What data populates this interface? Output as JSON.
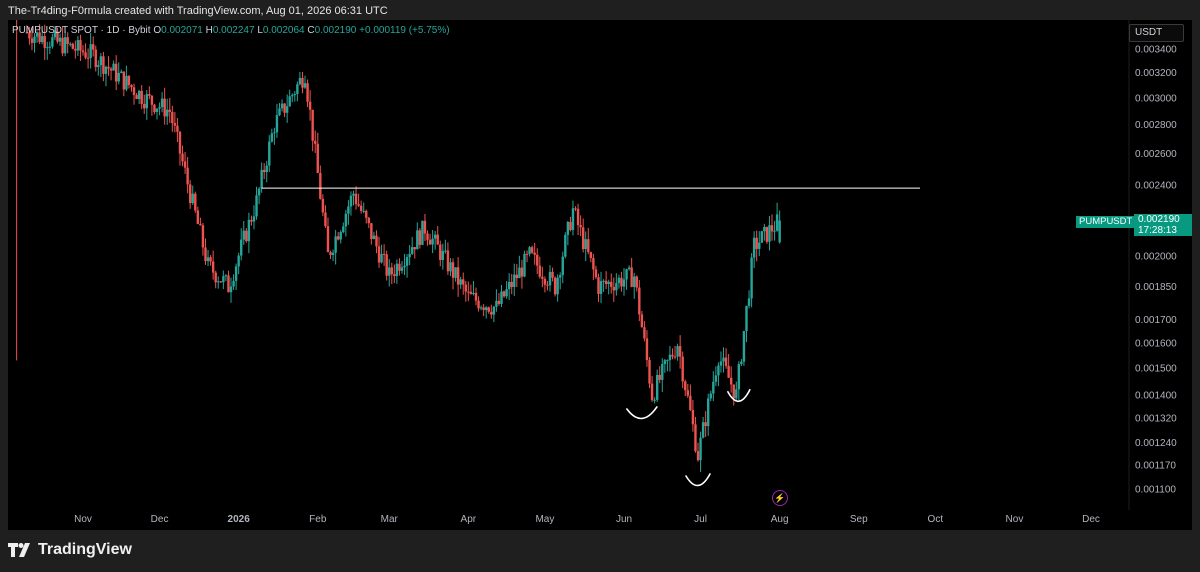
{
  "caption": "The-Tr4ding-F0rmula created with TradingView.com, Aug 01, 2026 06:31 UTC",
  "legend": {
    "symbol": "PUMPUSDT SPOT · 1D · Bybit",
    "o_label": "O",
    "o_value": "0.002071",
    "h_label": "H",
    "h_value": "0.002247",
    "l_label": "L",
    "l_value": "0.002064",
    "c_label": "C",
    "c_value": "0.002190",
    "change": "+0.000119 (+5.75%)"
  },
  "currency": "USDT",
  "price_tag": {
    "price": "0.002190",
    "countdown": "17:28:13"
  },
  "symbol_tag": "PUMPUSDT",
  "brand": "TradingView",
  "colors": {
    "up": "#26a69a",
    "down": "#ef5350",
    "tag": "#089981",
    "alert": "#9c27b0",
    "line": "#ffffff"
  },
  "icons": {
    "alert": "lightning-icon",
    "logo": "tradingview-logo-icon"
  },
  "chart_data": {
    "type": "candlestick",
    "title": "PUMPUSDT SPOT · 1D · Bybit",
    "y_ticks": [
      "0.003400",
      "0.003200",
      "0.003000",
      "0.002800",
      "0.002600",
      "0.002400",
      "0.002000",
      "0.001850",
      "0.001700",
      "0.001600",
      "0.001500",
      "0.001400",
      "0.001320",
      "0.001240",
      "0.001170",
      "0.001100"
    ],
    "x_ticks": [
      "Nov",
      "Dec",
      "2026",
      "Feb",
      "Mar",
      "Apr",
      "May",
      "Jun",
      "Jul",
      "Aug",
      "Sep",
      "Oct",
      "Nov",
      "Dec"
    ],
    "x_range": [
      "2025-10-06",
      "2026-12-31"
    ],
    "y_scale": "log",
    "horizontal_line": {
      "price": 0.00238,
      "from": "2026-01-10",
      "to": "2026-09-25"
    },
    "key_points": [
      {
        "date": "2025-10-10",
        "close": 0.00355
      },
      {
        "date": "2025-11-05",
        "close": 0.00335
      },
      {
        "date": "2025-11-25",
        "close": 0.003
      },
      {
        "date": "2025-12-05",
        "close": 0.0029
      },
      {
        "date": "2025-12-20",
        "close": 0.00195
      },
      {
        "date": "2025-12-28",
        "close": 0.00185
      },
      {
        "date": "2026-01-08",
        "close": 0.0023
      },
      {
        "date": "2026-01-15",
        "close": 0.0028
      },
      {
        "date": "2026-01-27",
        "close": 0.0032
      },
      {
        "date": "2026-02-05",
        "close": 0.002
      },
      {
        "date": "2026-02-15",
        "close": 0.00235
      },
      {
        "date": "2026-03-01",
        "close": 0.0019
      },
      {
        "date": "2026-03-15",
        "close": 0.00215
      },
      {
        "date": "2026-04-01",
        "close": 0.0018
      },
      {
        "date": "2026-04-12",
        "close": 0.00175
      },
      {
        "date": "2026-04-25",
        "close": 0.002
      },
      {
        "date": "2026-05-05",
        "close": 0.00185
      },
      {
        "date": "2026-05-12",
        "close": 0.00225
      },
      {
        "date": "2026-05-22",
        "close": 0.00185
      },
      {
        "date": "2026-06-05",
        "close": 0.0019
      },
      {
        "date": "2026-06-12",
        "close": 0.0014
      },
      {
        "date": "2026-06-22",
        "close": 0.0016
      },
      {
        "date": "2026-06-30",
        "close": 0.0012
      },
      {
        "date": "2026-07-08",
        "close": 0.00155
      },
      {
        "date": "2026-07-15",
        "close": 0.0014
      },
      {
        "date": "2026-07-22",
        "close": 0.00205
      },
      {
        "date": "2026-08-01",
        "close": 0.00219
      }
    ],
    "last_candle": {
      "date": "2026-08-01",
      "open": 0.002071,
      "high": 0.002247,
      "low": 0.002064,
      "close": 0.00219
    }
  }
}
